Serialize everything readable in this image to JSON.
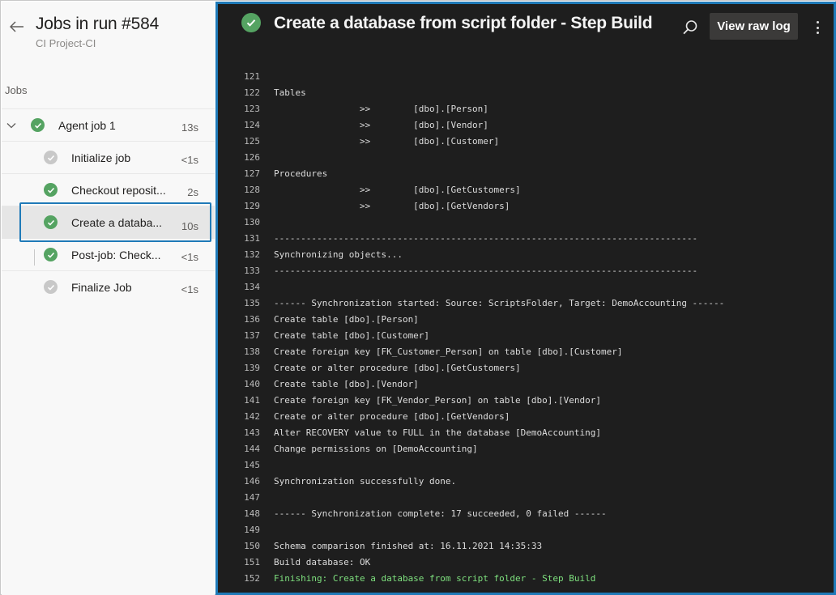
{
  "sidebar": {
    "title": "Jobs in run #584",
    "subtitle": "CI Project-CI",
    "section_label": "Jobs",
    "jobs": [
      {
        "label": "Agent job 1",
        "duration": "13s",
        "status": "success"
      },
      {
        "label": "Initialize job",
        "duration": "<1s",
        "status": "skipped"
      },
      {
        "label": "Checkout reposit...",
        "duration": "2s",
        "status": "success"
      },
      {
        "label": "Create a databa...",
        "duration": "10s",
        "status": "success"
      },
      {
        "label": "Post-job: Check...",
        "duration": "<1s",
        "status": "success"
      },
      {
        "label": "Finalize Job",
        "duration": "<1s",
        "status": "skipped"
      }
    ]
  },
  "log": {
    "title": "Create a database from script folder - Step Build",
    "view_raw_label": "View raw log",
    "lines": [
      {
        "n": "121",
        "t": ""
      },
      {
        "n": "122",
        "t": "Tables"
      },
      {
        "n": "123",
        "t": "                >>        [dbo].[Person]"
      },
      {
        "n": "124",
        "t": "                >>        [dbo].[Vendor]"
      },
      {
        "n": "125",
        "t": "                >>        [dbo].[Customer]"
      },
      {
        "n": "126",
        "t": ""
      },
      {
        "n": "127",
        "t": "Procedures"
      },
      {
        "n": "128",
        "t": "                >>        [dbo].[GetCustomers]"
      },
      {
        "n": "129",
        "t": "                >>        [dbo].[GetVendors]"
      },
      {
        "n": "130",
        "t": ""
      },
      {
        "n": "131",
        "t": "-------------------------------------------------------------------------------"
      },
      {
        "n": "132",
        "t": "Synchronizing objects..."
      },
      {
        "n": "133",
        "t": "-------------------------------------------------------------------------------"
      },
      {
        "n": "134",
        "t": ""
      },
      {
        "n": "135",
        "t": "------ Synchronization started: Source: ScriptsFolder, Target: DemoAccounting ------"
      },
      {
        "n": "136",
        "t": "Create table [dbo].[Person]"
      },
      {
        "n": "137",
        "t": "Create table [dbo].[Customer]"
      },
      {
        "n": "138",
        "t": "Create foreign key [FK_Customer_Person] on table [dbo].[Customer]"
      },
      {
        "n": "139",
        "t": "Create or alter procedure [dbo].[GetCustomers]"
      },
      {
        "n": "140",
        "t": "Create table [dbo].[Vendor]"
      },
      {
        "n": "141",
        "t": "Create foreign key [FK_Vendor_Person] on table [dbo].[Vendor]"
      },
      {
        "n": "142",
        "t": "Create or alter procedure [dbo].[GetVendors]"
      },
      {
        "n": "143",
        "t": "Alter RECOVERY value to FULL in the database [DemoAccounting]"
      },
      {
        "n": "144",
        "t": "Change permissions on [DemoAccounting]"
      },
      {
        "n": "145",
        "t": ""
      },
      {
        "n": "146",
        "t": "Synchronization successfully done."
      },
      {
        "n": "147",
        "t": ""
      },
      {
        "n": "148",
        "t": "------ Synchronization complete: 17 succeeded, 0 failed ------"
      },
      {
        "n": "149",
        "t": ""
      },
      {
        "n": "150",
        "t": "Schema comparison finished at: 16.11.2021 14:35:33"
      },
      {
        "n": "151",
        "t": "Build database: OK"
      },
      {
        "n": "152",
        "t": "Finishing: Create a database from script folder - Step Build"
      }
    ]
  },
  "colors": {
    "accent": "#1f7ab8",
    "success": "#55a362",
    "log_background": "#1e1e1e",
    "finish_text": "#7ee07e"
  }
}
